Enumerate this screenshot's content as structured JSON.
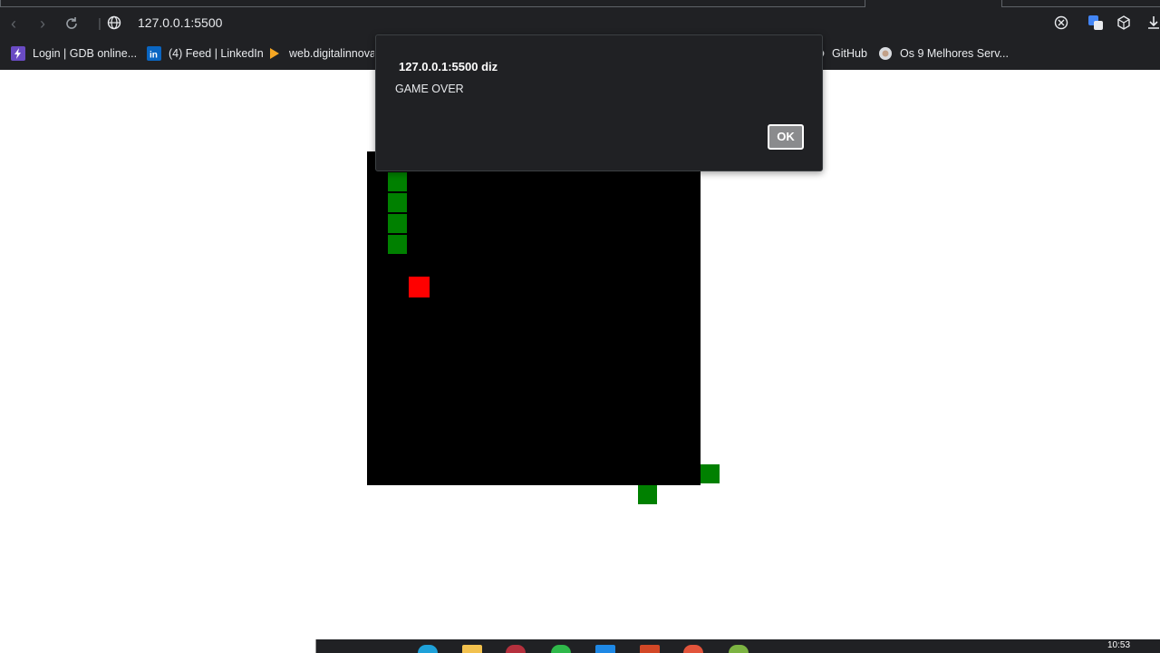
{
  "browser": {
    "url": "127.0.0.1:5500",
    "bookmarks": [
      {
        "label": "Login | GDB online...",
        "icon": "bolt-icon"
      },
      {
        "label": "(4) Feed | LinkedIn",
        "icon": "linkedin-icon"
      },
      {
        "label": "web.digitalinnovat",
        "icon": "dio-icon"
      },
      {
        "label": "GitHub",
        "icon": "github-icon"
      },
      {
        "label": "Os 9 Melhores Serv...",
        "icon": "site-icon"
      }
    ]
  },
  "dialog": {
    "title": "127.0.0.1:5500 diz",
    "message": "GAME OVER",
    "ok_label": "OK"
  },
  "game": {
    "background": "#000000",
    "snake_color": "#008000",
    "food_color": "#ff0000",
    "state": "game over"
  },
  "taskbar": {
    "time": "10:53"
  },
  "colors": {
    "chrome_bg": "#202124",
    "text_light": "#e8eaed"
  }
}
